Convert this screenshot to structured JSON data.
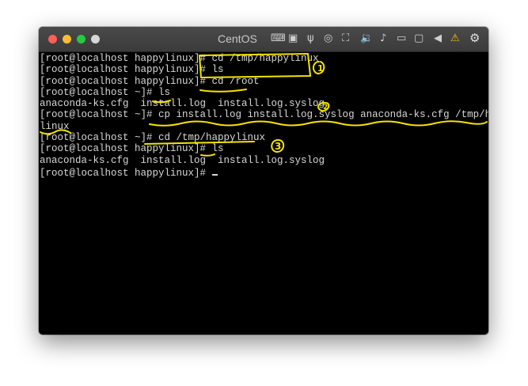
{
  "window": {
    "title": "CentOS"
  },
  "toolbar_icons": [
    "keyboard-icon",
    "cpu-icon",
    "usb-icon",
    "optical-drive-icon",
    "network-icon",
    "speaker-icon",
    "microphone-icon",
    "storage-icon",
    "display-icon",
    "arrow-left-icon",
    "warning-icon",
    "gear-icon"
  ],
  "terminal": {
    "lines": [
      "[root@localhost happylinux]# cd /tmp/happylinux",
      "[root@localhost happylinux]# ls",
      "[root@localhost happylinux]# cd /root",
      "[root@localhost ~]# ls",
      "anaconda-ks.cfg  install.log  install.log.syslog",
      "[root@localhost ~]# cp install.log install.log.syslog anaconda-ks.cfg /tmp/happy",
      "linux",
      "[root@localhost ~]# cd /tmp/happylinux",
      "[root@localhost happylinux]# ls",
      "anaconda-ks.cfg  install.log  install.log.syslog",
      "[root@localhost happylinux]# "
    ]
  },
  "annotations": {
    "step1": "1",
    "step2": "2",
    "step3": "3",
    "highlight_color": "#f5e400"
  }
}
